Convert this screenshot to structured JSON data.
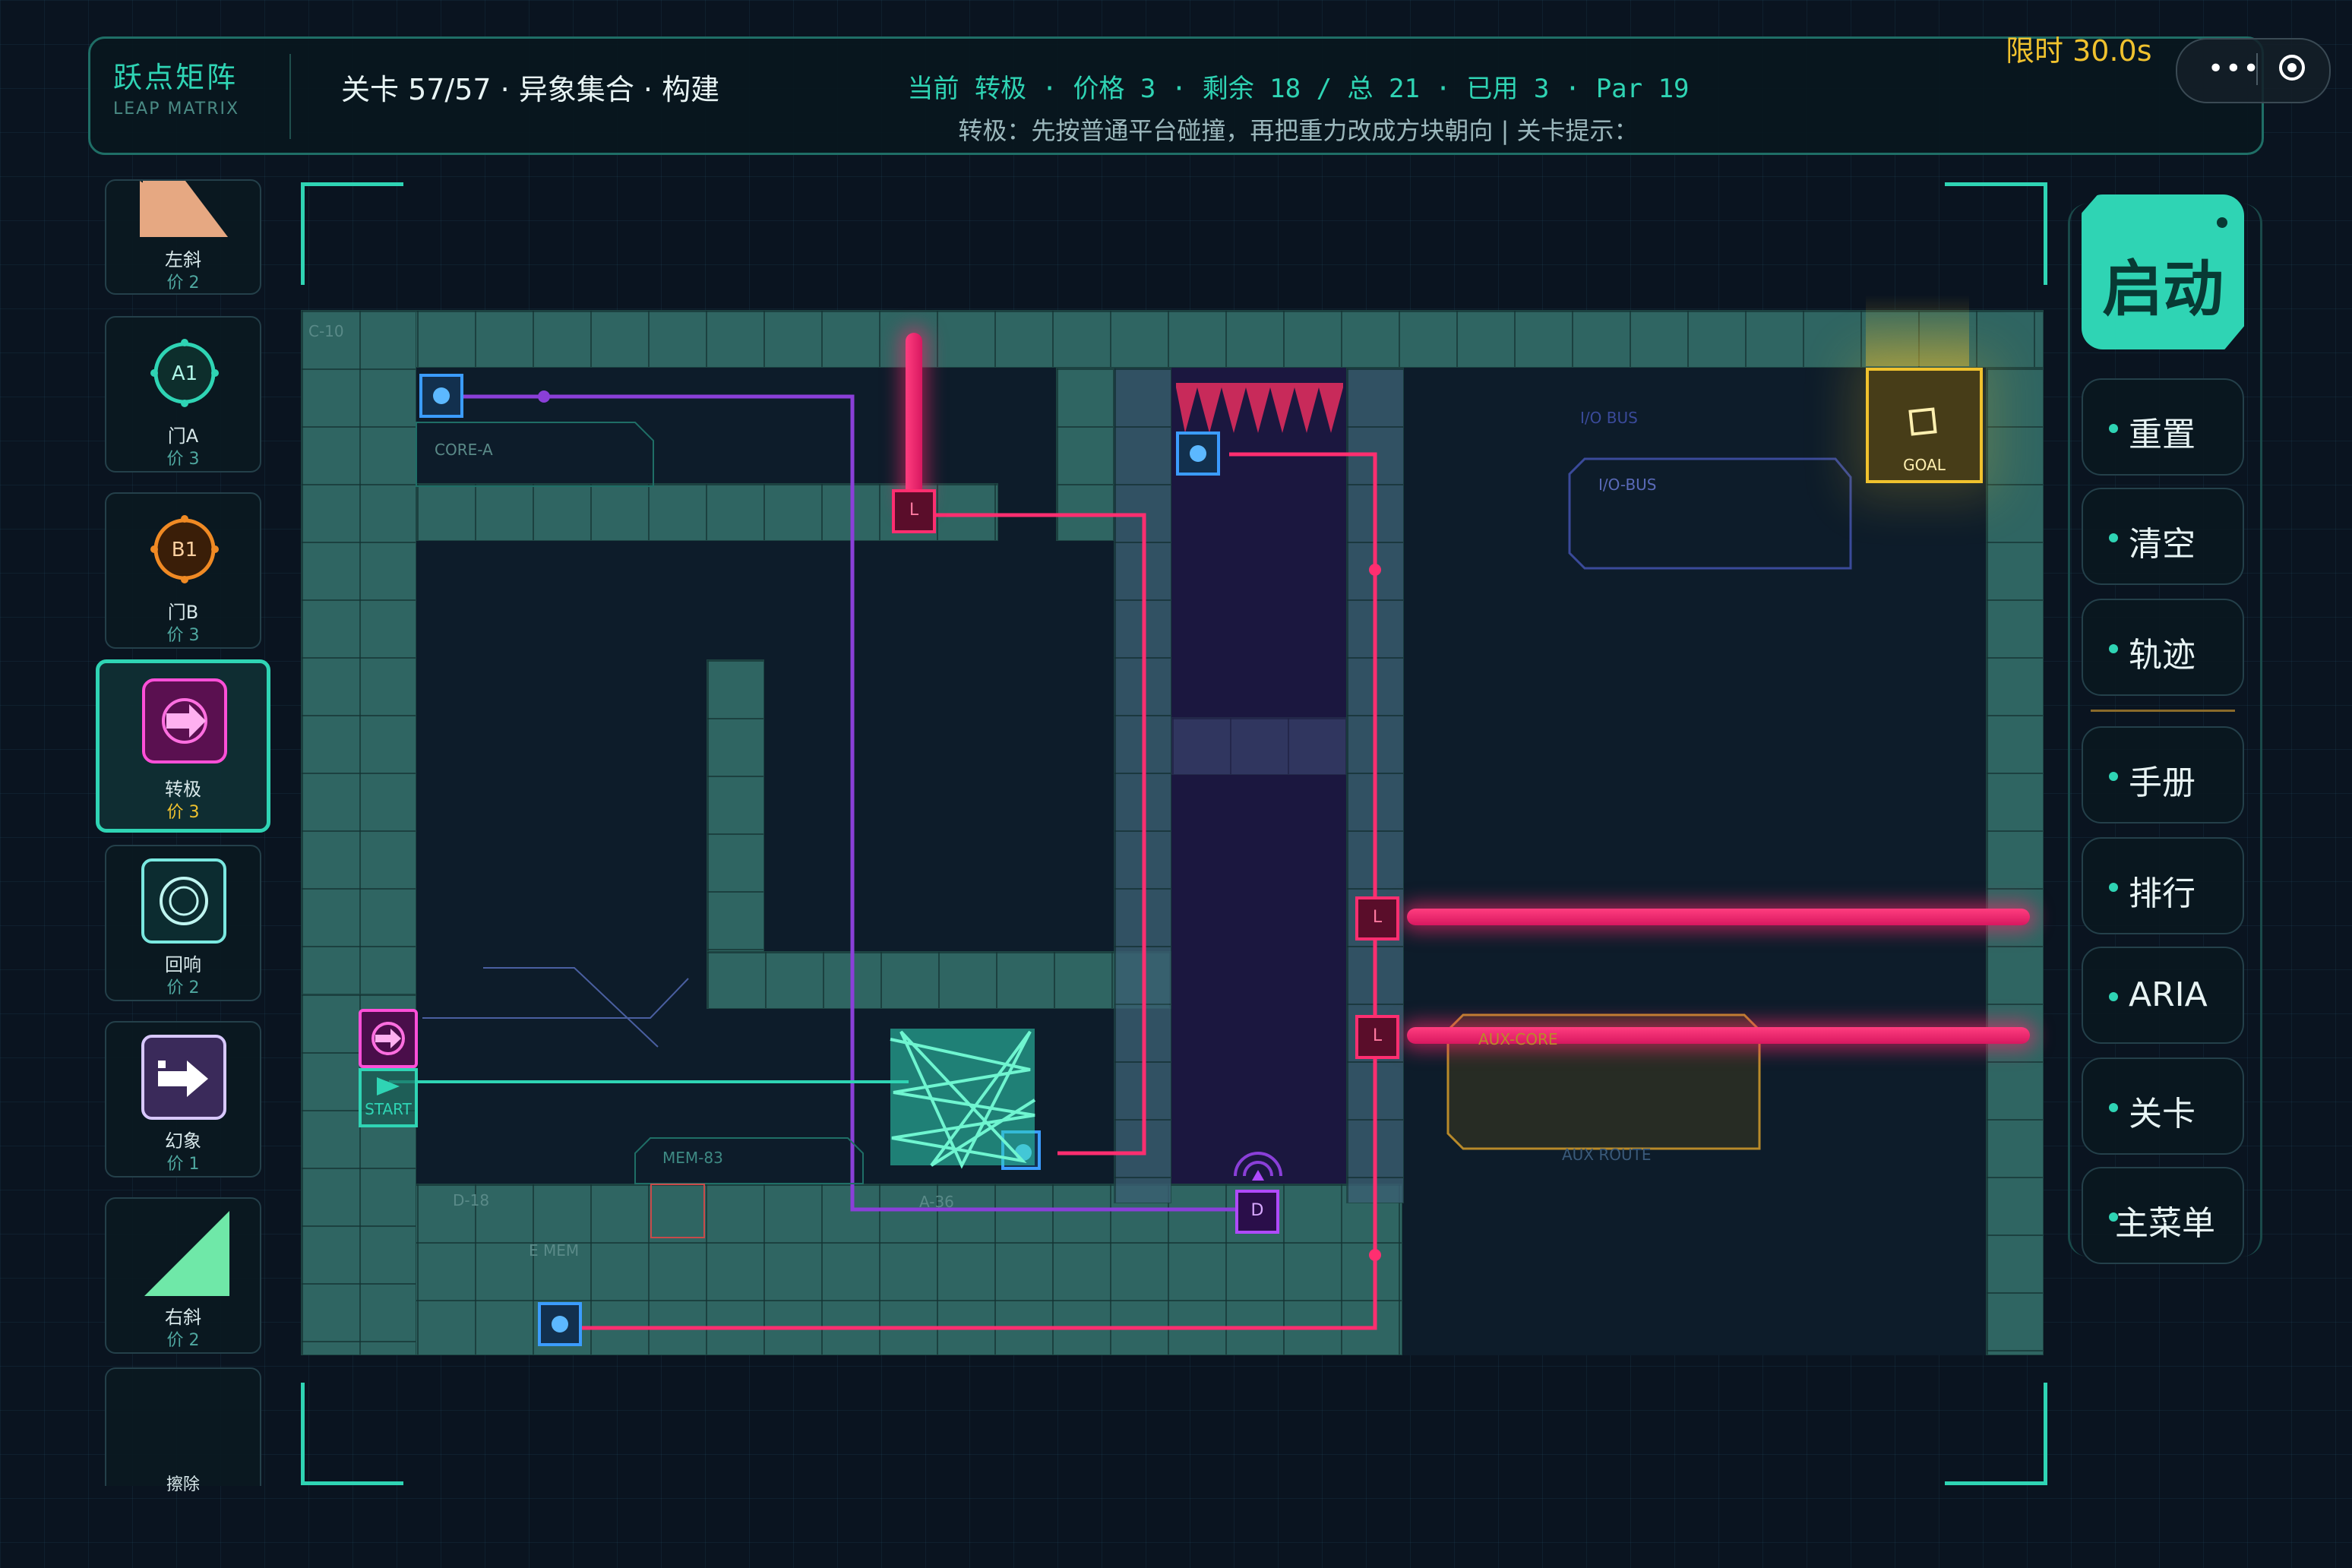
{
  "header": {
    "logo_title": "跃点矩阵",
    "logo_subtitle": "LEAP MATRIX",
    "level_line": "关卡 57/57 · 异象集合 · 构建",
    "status_line": "当前 转极 · 价格 3 · 剩余 18 / 总 21 · 已用 3 · Par 19",
    "hint_line": "转极：先按普通平台碰撞，再把重力改成方块朝向 | 关卡提示：",
    "timer_label": "限时",
    "timer_value": "30.0s",
    "menu_dots": "•••"
  },
  "palette": [
    {
      "name": "左斜",
      "price": "价 2",
      "icon": "left-slope-icon"
    },
    {
      "name": "门A",
      "price": "价 3",
      "icon": "gate-a-icon",
      "badge": "A1"
    },
    {
      "name": "门B",
      "price": "价 3",
      "icon": "gate-b-icon",
      "badge": "B1"
    },
    {
      "name": "转极",
      "price": "价 3",
      "icon": "polarity-icon",
      "selected": true
    },
    {
      "name": "回响",
      "price": "价 2",
      "icon": "echo-icon"
    },
    {
      "name": "幻象",
      "price": "价 1",
      "icon": "phantom-icon"
    },
    {
      "name": "右斜",
      "price": "价 2",
      "icon": "right-slope-icon"
    },
    {
      "name": "擦除",
      "price": "",
      "icon": "erase-icon"
    }
  ],
  "board": {
    "labels": {
      "start": "START",
      "goal": "GOAL",
      "core_a": "CORE-A",
      "io_bus": "I/O-BUS",
      "io_bus_small": "I/O BUS",
      "mem_83": "MEM-83",
      "aux_core": "AUX-CORE",
      "aux_route": "AUX ROUTE",
      "c_10": "C-10",
      "d_18": "D-18",
      "a_36": "A-36",
      "mem": "E MEM"
    },
    "emitter_letter": "L",
    "door_letter": "D"
  },
  "menu": {
    "start": "启动",
    "items": [
      "重置",
      "清空",
      "轨迹",
      "手册",
      "排行",
      "ARIA",
      "关卡",
      "主菜单"
    ]
  },
  "colors": {
    "accent": "#2fd4b4",
    "laser": "#ff2e70",
    "goal": "#f0c22e",
    "wire_purple": "#8a3fd8",
    "wall": "#2f6562"
  }
}
